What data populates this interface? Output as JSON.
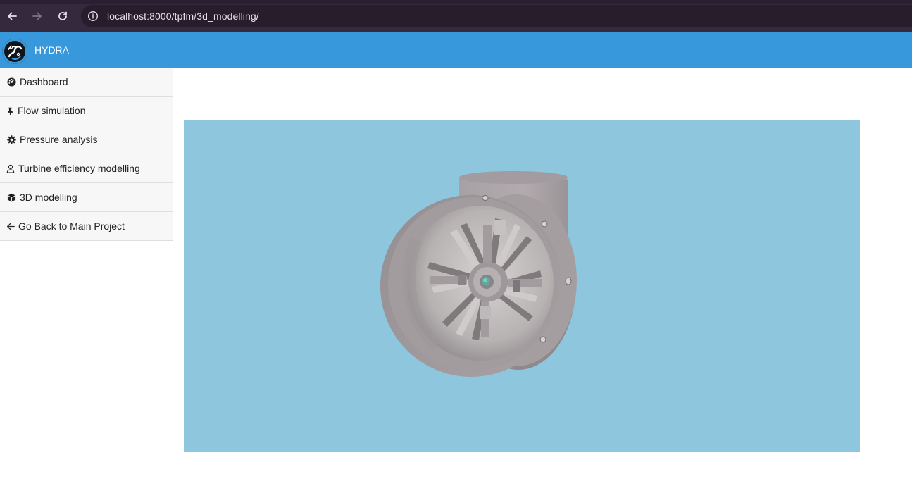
{
  "browser": {
    "url": "localhost:8000/tpfm/3d_modelling/",
    "back_icon": "arrow-left-icon",
    "forward_icon": "arrow-right-icon",
    "reload_icon": "reload-icon",
    "info_icon": "info-icon"
  },
  "header": {
    "brand": "HYDRA",
    "color": "#3898dc"
  },
  "sidebar": {
    "items": [
      {
        "label": "Dashboard",
        "icon": "dashboard-icon"
      },
      {
        "label": "Flow simulation",
        "icon": "pin-icon"
      },
      {
        "label": "Pressure analysis",
        "icon": "gear-icon"
      },
      {
        "label": "Turbine efficiency modelling",
        "icon": "user-icon"
      },
      {
        "label": "3D modelling",
        "icon": "cube-icon"
      },
      {
        "label": "Go Back to Main Project",
        "icon": "arrow-left-icon"
      }
    ]
  },
  "viewer": {
    "background": "#8dc6dd",
    "model": "turbine-3d-model"
  }
}
